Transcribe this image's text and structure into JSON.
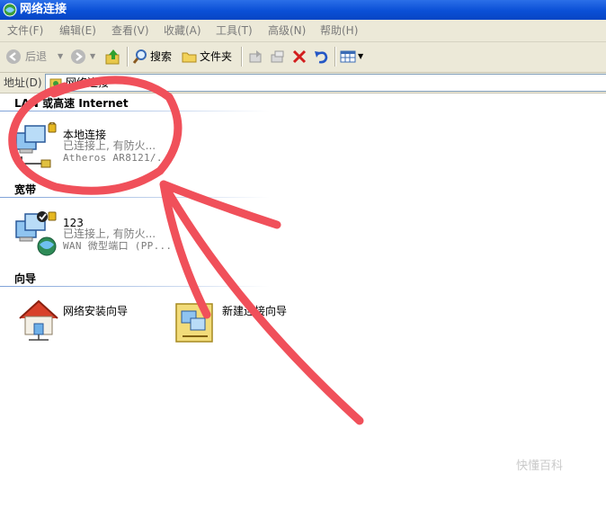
{
  "window": {
    "title": "网络连接"
  },
  "menu": [
    "文件(F)",
    "编辑(E)",
    "查看(V)",
    "收藏(A)",
    "工具(T)",
    "高级(N)",
    "帮助(H)"
  ],
  "toolbar": {
    "back": "后退",
    "search": "搜索",
    "folders": "文件夹"
  },
  "address": {
    "label": "地址(D)",
    "value": "网络连接"
  },
  "groups": [
    {
      "title": "LAN 或高速 Internet",
      "items": [
        {
          "name": "本地连接",
          "status": "已连接上, 有防火...",
          "device": "Atheros AR8121/..."
        }
      ]
    },
    {
      "title": "宽带",
      "items": [
        {
          "name": "123",
          "status": "已连接上, 有防火...",
          "device": "WAN 微型端口 (PP..."
        }
      ]
    },
    {
      "title": "向导",
      "items": [
        {
          "name": "网络安装向导"
        },
        {
          "name": "新建连接向导"
        }
      ]
    }
  ],
  "watermark": "快懂百科",
  "colors": {
    "titlebar": "#0a4fd6",
    "chrome": "#ece9d8",
    "annotation": "#f0505a"
  }
}
